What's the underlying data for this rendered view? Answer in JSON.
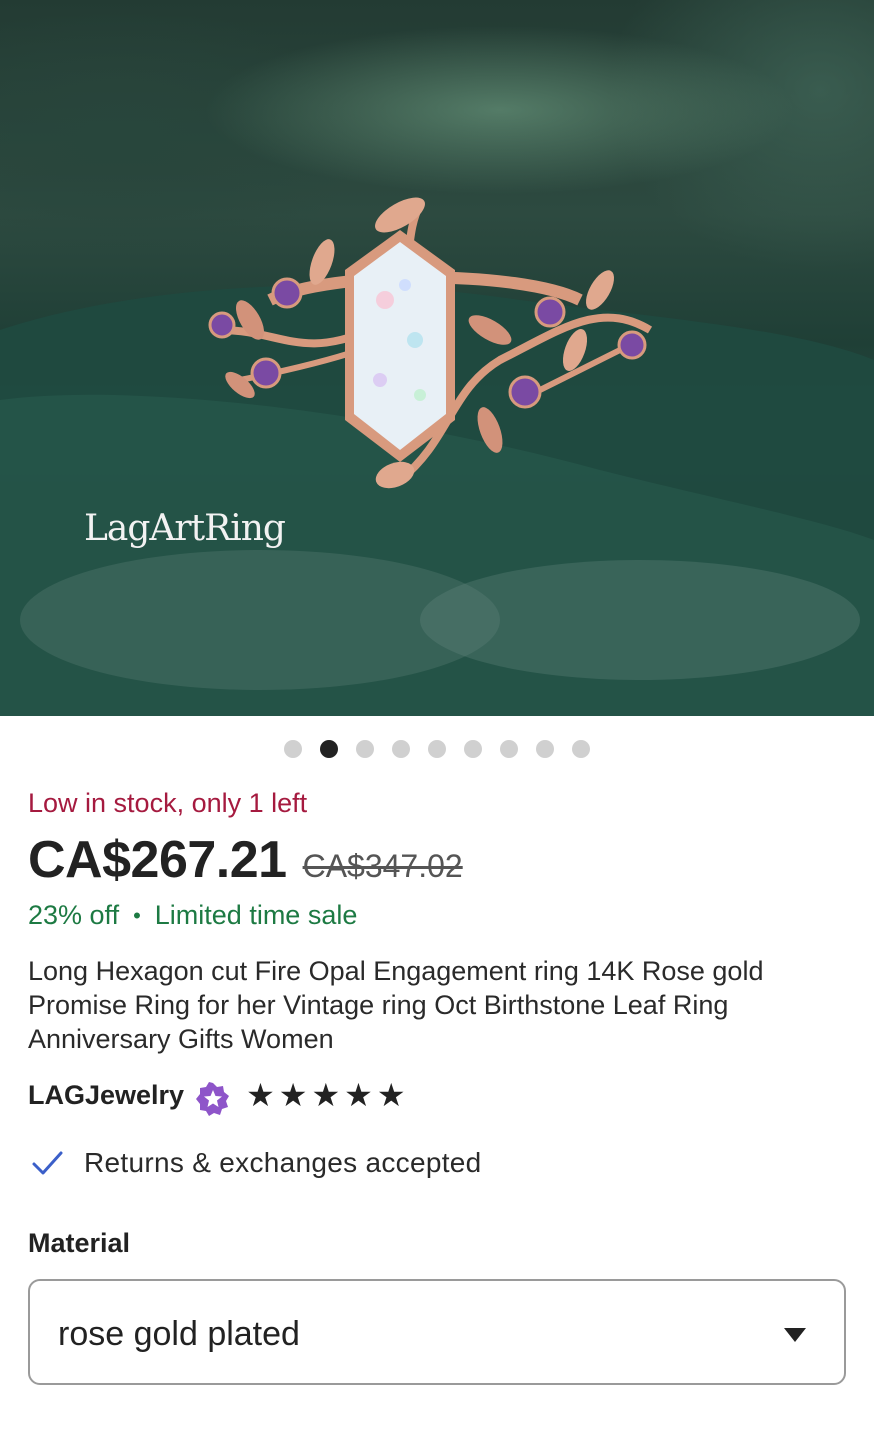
{
  "hero": {
    "brand_watermark": "LagArtRing",
    "image_count": 9,
    "active_index": 1
  },
  "listing": {
    "stock_notice": "Low in stock, only 1 left",
    "price": "CA$267.21",
    "original_price": "CA$347.02",
    "discount": "23% off",
    "sale_label": "Limited time sale",
    "separator": "•",
    "title": "Long Hexagon cut Fire Opal Engagement ring 14K Rose gold Promise Ring for her Vintage ring Oct Birthstone Leaf Ring Anniversary Gifts Women"
  },
  "shop": {
    "name": "LAGJewelry",
    "badge_icon": "star-seller-badge-icon",
    "rating": 5,
    "star_glyph": "★"
  },
  "returns": {
    "label": "Returns & exchanges accepted",
    "icon": "checkmark-icon"
  },
  "material": {
    "label": "Material",
    "selected": "rose gold plated",
    "icon": "caret-down-icon"
  },
  "colors": {
    "stock_red": "#a51a3f",
    "sale_green": "#1d7a43",
    "check_blue": "#3b5fc9",
    "badge_purple": "#8e55c9",
    "rose_gold": "#d89a7e",
    "opal": "#e8f0f6",
    "amethyst": "#7a4aa3"
  }
}
